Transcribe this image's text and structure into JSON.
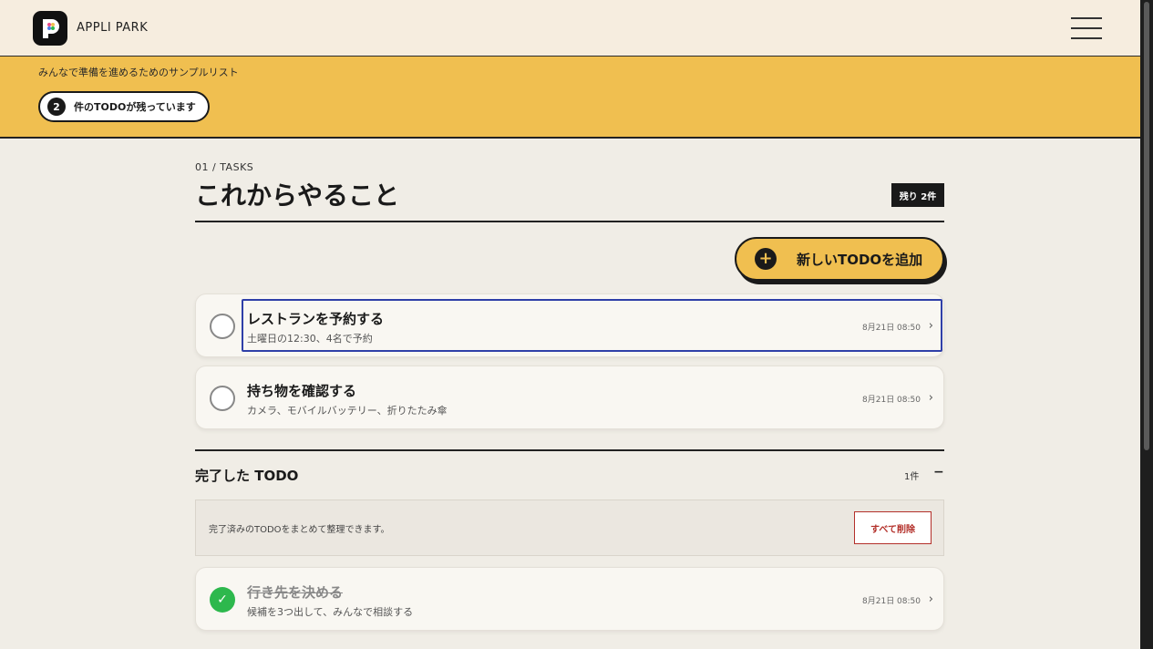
{
  "header": {
    "logo_letter": "P",
    "app_name": "APPLI PARK",
    "menu_icon": "hamburger-menu-icon"
  },
  "banner": {
    "subtitle": "みんなで準備を進めるためのサンプルリスト",
    "remaining_number": "2",
    "remaining_text": "件のTODOが残っています"
  },
  "tasks_section": {
    "eyebrow": "01 / TASKS",
    "title": "これからやること",
    "remaining_badge": "残り 2件",
    "add_button_label": "新しいTODOを追加",
    "items": [
      {
        "title": "レストランを予約する",
        "description": "土曜日の12:30、4名で予約",
        "time": "8月21日 08:50",
        "done": false
      },
      {
        "title": "持ち物を確認する",
        "description": "カメラ、モバイルバッテリー、折りたたみ傘",
        "time": "8月21日 08:50",
        "done": false
      }
    ]
  },
  "done_section": {
    "heading": "完了した TODO",
    "count": "1件",
    "collapse_symbol": "−",
    "bulk_description": "完了済みのTODOをまとめて整理できます。",
    "delete_all_label": "すべて削除",
    "items": [
      {
        "title": "行き先を決める",
        "description": "候補を3つ出して、みんなで相談する",
        "time": "8月21日 08:50",
        "done": true
      }
    ]
  },
  "colors": {
    "accent_yellow": "#f0bf50",
    "done_green": "#2db84d",
    "danger_red": "#b3302a",
    "focus_blue": "#2f3fa8"
  }
}
